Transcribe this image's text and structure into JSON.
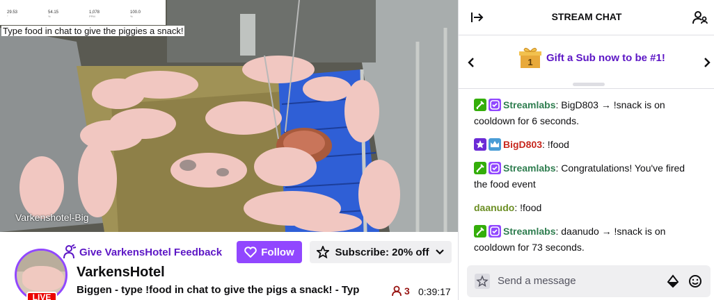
{
  "video": {
    "overlay_text": "Type food in chat to give the piggies a snack!",
    "camera_label": "Varkenshotel-Big",
    "stats": [
      {
        "value": "29.53",
        "unit": "°"
      },
      {
        "value": "54.15",
        "unit": "%"
      },
      {
        "value": "1,078",
        "unit": "PPM"
      },
      {
        "value": "100.0",
        "unit": "%"
      }
    ]
  },
  "channel": {
    "feedback_label": "Give VarkensHotel Feedback",
    "follow_label": "Follow",
    "subscribe_label": "Subscribe: 20% off",
    "name": "VarkensHotel",
    "title": "Biggen - type !food in chat to give the pigs a snack! - Typ",
    "live_label": "LIVE",
    "viewers": "3",
    "uptime": "0:39:17"
  },
  "chat": {
    "header_title": "STREAM CHAT",
    "gift_text": "Gift a Sub now to be #1!",
    "gift_rank": "1",
    "messages": [
      {
        "user": "Streamlabs",
        "user_color": "#2e7d4f",
        "text": ": BigD803 → !snack is on cooldown for 6 seconds."
      },
      {
        "user": "BigD803",
        "user_color": "#c7271e",
        "text": ": !food"
      },
      {
        "user": "Streamlabs",
        "user_color": "#2e7d4f",
        "text": ": Congratulations! You've fired the food event"
      },
      {
        "user": "daanudo",
        "user_color": "#6b8e23",
        "text": ": !food"
      },
      {
        "user": "Streamlabs",
        "user_color": "#2e7d4f",
        "text": ": daanudo → !snack is on cooldown for 73 seconds."
      }
    ],
    "input_placeholder": "Send a message"
  },
  "colors": {
    "accent": "#9147ff",
    "accent_dark": "#5c16c5",
    "live": "#eb0400"
  }
}
